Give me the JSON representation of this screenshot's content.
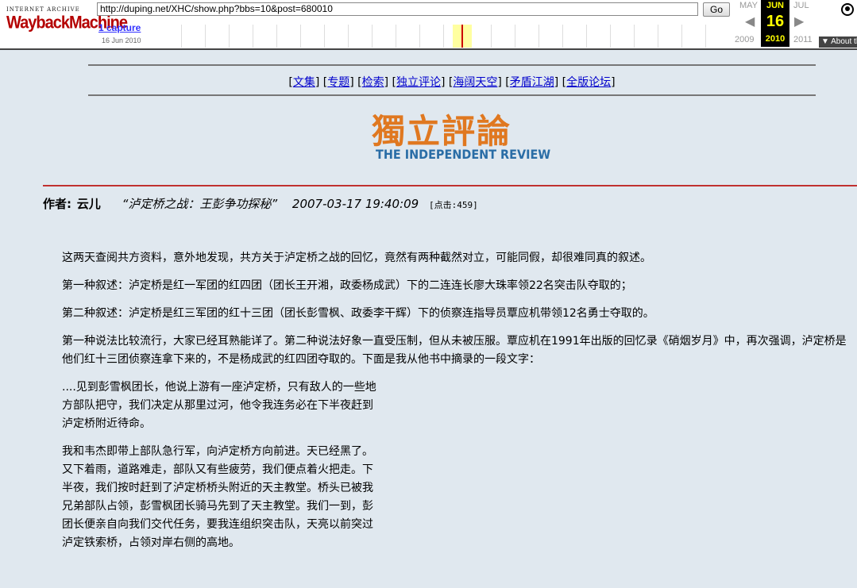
{
  "wayback": {
    "logo_top": "INTERNET ARCHIVE",
    "logo_main": "WaybackMachine",
    "url": "http://duping.net/XHC/show.php?bbs=10&post=680010",
    "go_label": "Go",
    "captures_label": "1 capture",
    "capture_date": "16 Jun 2010",
    "prev_month": "MAY",
    "cur_month": "JUN",
    "next_month": "JUL",
    "cur_day": "16",
    "prev_year": "2009",
    "cur_year": "2010",
    "next_year": "2011",
    "about_label": "▼ About this capture"
  },
  "nav": {
    "items": [
      "文集",
      "专题",
      "检索",
      "独立评论",
      "海阔天空",
      "矛盾江湖",
      "全版论坛"
    ]
  },
  "logo": {
    "chinese": "獨立評論",
    "english": "THE INDEPENDENT REVIEW"
  },
  "article": {
    "author_label": "作者:",
    "author": "云儿",
    "title": "“泸定桥之战：王彭争功探秘”",
    "date": "2007-03-17 19:40:09",
    "hits": "[点击:459]",
    "paragraphs": [
      "这两天查阅共方资料，意外地发现，共方关于泸定桥之战的回忆，竟然有两种截然对立，可能同假，却很难同真的叙述。",
      "第一种叙述：泸定桥是红一军团的红四团（团长王开湘，政委杨成武）下的二连连长廖大珠率领22名突击队夺取的；",
      "第二种叙述：泸定桥是红三军团的红十三团（团长彭雪枫、政委李干辉）下的侦察连指导员覃应机带领12名勇士夺取的。",
      "第一种说法比较流行，大家已经耳熟能详了。第二种说法好象一直受压制，但从未被压服。覃应机在1991年出版的回忆录《硝烟岁月》中，再次强调，泸定桥是他们红十三团侦察连拿下来的，不是杨成武的红四团夺取的。下面是我从他书中摘录的一段文字：",
      "....见到彭雪枫团长，他说上游有一座泸定桥，只有敌人的一些地方部队把守，我们决定从那里过河，他令我连务必在下半夜赶到泸定桥附近待命。",
      "我和韦杰即带上部队急行军，向泸定桥方向前进。天已经黑了。又下着雨，道路难走，部队又有些疲劳，我们便点着火把走。下半夜，我们按时赶到了泸定桥桥头附近的天主教堂。桥头已被我兄弟部队占领，彭雪枫团长骑马先到了天主教堂。我们一到，彭团长便亲自向我们交代任务，要我连组织突击队，天亮以前突过泸定铁索桥，占领对岸右侧的高地。"
    ]
  }
}
